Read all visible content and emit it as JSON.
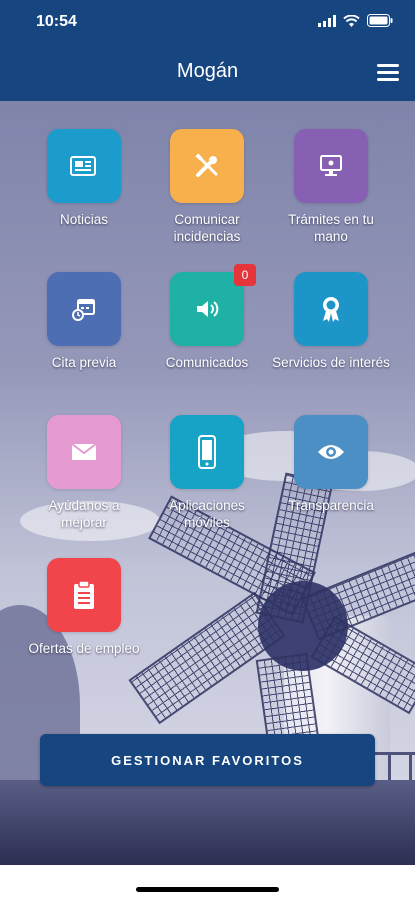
{
  "status_bar": {
    "time": "10:54"
  },
  "header": {
    "title": "Mogán"
  },
  "grid": [
    {
      "label": "Noticias",
      "icon": "newspaper-icon",
      "color": "#1b9ccd",
      "badge": ""
    },
    {
      "label": "Comunicar incidencias",
      "icon": "tools-icon",
      "color": "#f7b04c",
      "badge": ""
    },
    {
      "label": "Trámites en tu mano",
      "icon": "computer-icon",
      "color": "#8860b3",
      "badge": ""
    },
    {
      "label": "Cita previa",
      "icon": "calendar-icon",
      "color": "#4e6eb4",
      "badge": ""
    },
    {
      "label": "Comunicados",
      "icon": "speaker-icon",
      "color": "#1fb1a5",
      "badge": "0"
    },
    {
      "label": "Servicios de interés",
      "icon": "award-icon",
      "color": "#1e95c8",
      "badge": ""
    },
    {
      "label": "Ayúdanos a mejorar",
      "icon": "envelope-icon",
      "color": "#e69ad2",
      "badge": ""
    },
    {
      "label": "Aplicaciones móviles",
      "icon": "phone-icon",
      "color": "#16a3c6",
      "badge": ""
    },
    {
      "label": "Transparencia",
      "icon": "eye-icon",
      "color": "#4c8fc4",
      "badge": ""
    },
    {
      "label": "Ofertas de empleo",
      "icon": "clipboard-icon",
      "color": "#f1444b",
      "badge": ""
    }
  ],
  "favorites_button": {
    "label": "GESTIONAR FAVORITOS"
  }
}
